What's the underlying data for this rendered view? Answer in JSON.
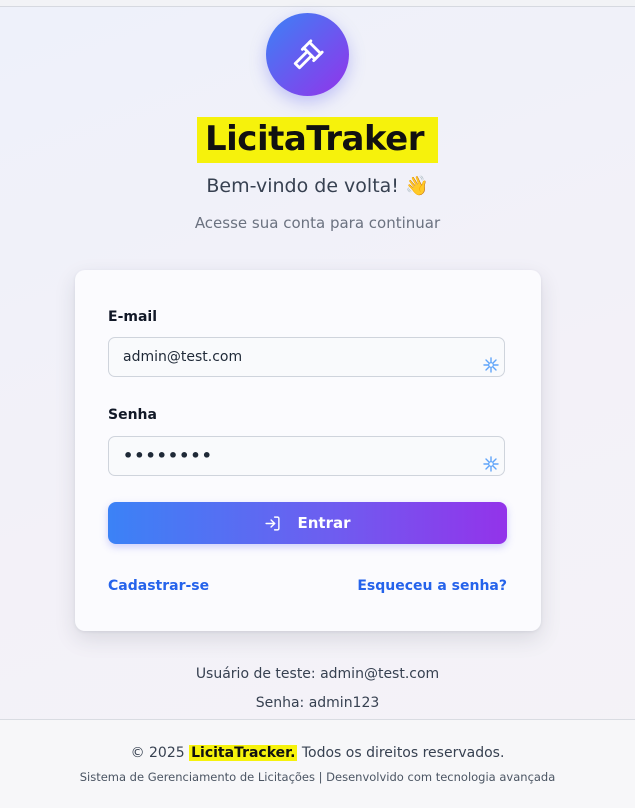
{
  "app": {
    "brand_name": "LicitaTraker",
    "welcome": "Bem-vindo de volta! 👋",
    "subtitle": "Acesse sua conta para continuar",
    "logo_icon": "gavel-icon",
    "colors": {
      "accent_start": "#3b82f6",
      "accent_end": "#9333ea",
      "link": "#2563eb",
      "highlight": "#f6f20c"
    }
  },
  "form": {
    "email_label": "E-mail",
    "email_value": "admin@test.com",
    "password_label": "Senha",
    "password_value": "••••••••",
    "submit_label": "Entrar",
    "register_link": "Cadastrar-se",
    "forgot_link": "Esqueceu a senha?"
  },
  "test_info": {
    "user": "Usuário de teste: admin@test.com",
    "password": "Senha: admin123"
  },
  "footer": {
    "copyright_prefix": "© 2025 ",
    "brand": "LicitaTracker.",
    "copyright_suffix": " Todos os direitos reservados.",
    "tagline": "Sistema de Gerenciamento de Licitações | Desenvolvido com tecnologia avançada"
  }
}
